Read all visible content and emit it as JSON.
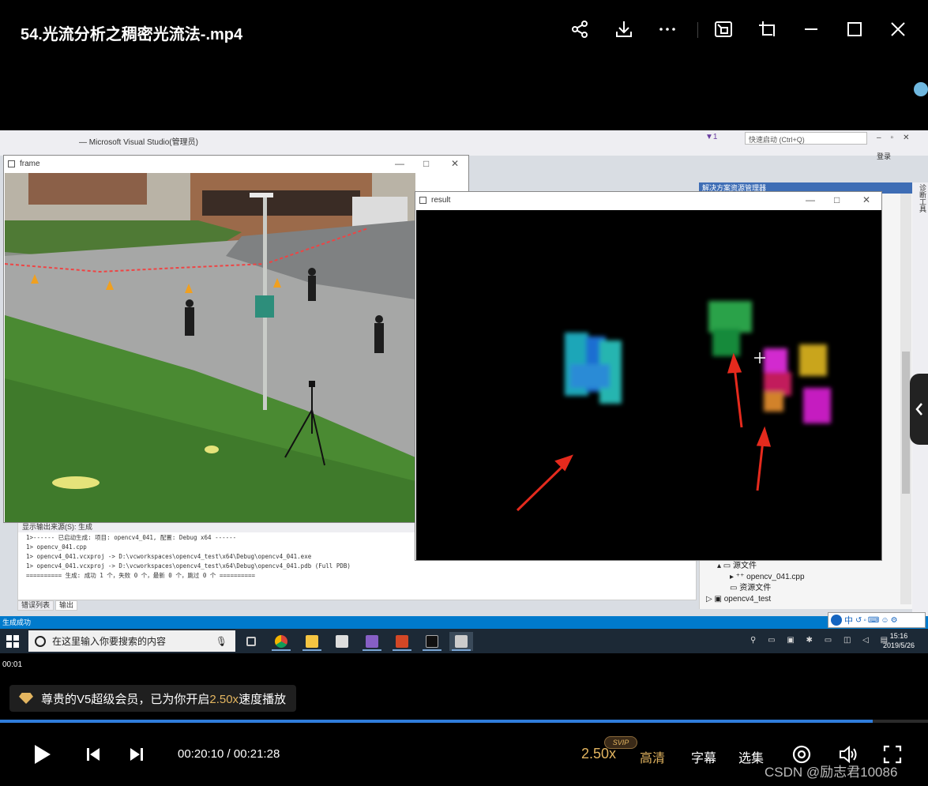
{
  "player": {
    "title": "54.光流分析之稠密光流法-.mp4",
    "current_time": "00:20:10",
    "total_time": "00:21:28",
    "time_display": "00:20:10 / 00:21:28",
    "small_time": "00:01",
    "speed_label": "2.50x",
    "svip_badge": "SVIP",
    "quality_label": "高清",
    "subtitle_label": "字幕",
    "episodes_label": "选集",
    "progress_fraction": 0.94,
    "toast": {
      "prefix": "尊贵的V5超级会员，已为你开启",
      "speed": "2.50x",
      "suffix": "速度播放"
    },
    "watermark": "CSDN @励志君10086",
    "accent_color": "#2f7ddb",
    "gold_color": "#e3b560"
  },
  "vs": {
    "title": "— Microsoft Visual Studio(管理员)",
    "search_placeholder": "快速启动 (Ctrl+Q)",
    "login": "登录",
    "panel_header": "解决方案资源管理器",
    "tools_label": "诊断工具",
    "output_header": "显示输出来源(S): 生成",
    "output_lines": [
      "1>------ 已启动生成: 项目: opencv4_041, 配置: Debug x64 ------",
      "1>  opencv_041.cpp",
      "1>  opencv4_041.vcxproj -> D:\\vcworkspaces\\opencv4_test\\x64\\Debug\\opencv4_041.exe",
      "1>  opencv4_041.vcxproj -> D:\\vcworkspaces\\opencv4_test\\x64\\Debug\\opencv4_041.pdb (Full PDB)",
      "========== 生成: 成功 1 个，失败 0 个，最新 0 个，跳过 0 个 =========="
    ],
    "output_tabs": [
      "错误列表",
      "输出"
    ],
    "status": "生成成功",
    "tree": [
      "源文件",
      "opencv_041.cpp",
      "资源文件",
      "opencv4_test"
    ],
    "ime": "中"
  },
  "windows": {
    "frame_title": "frame",
    "result_title": "result"
  },
  "taskbar": {
    "search_placeholder": "在这里输入你要搜索的内容",
    "time": "15:16",
    "date": "2019/5/26"
  }
}
